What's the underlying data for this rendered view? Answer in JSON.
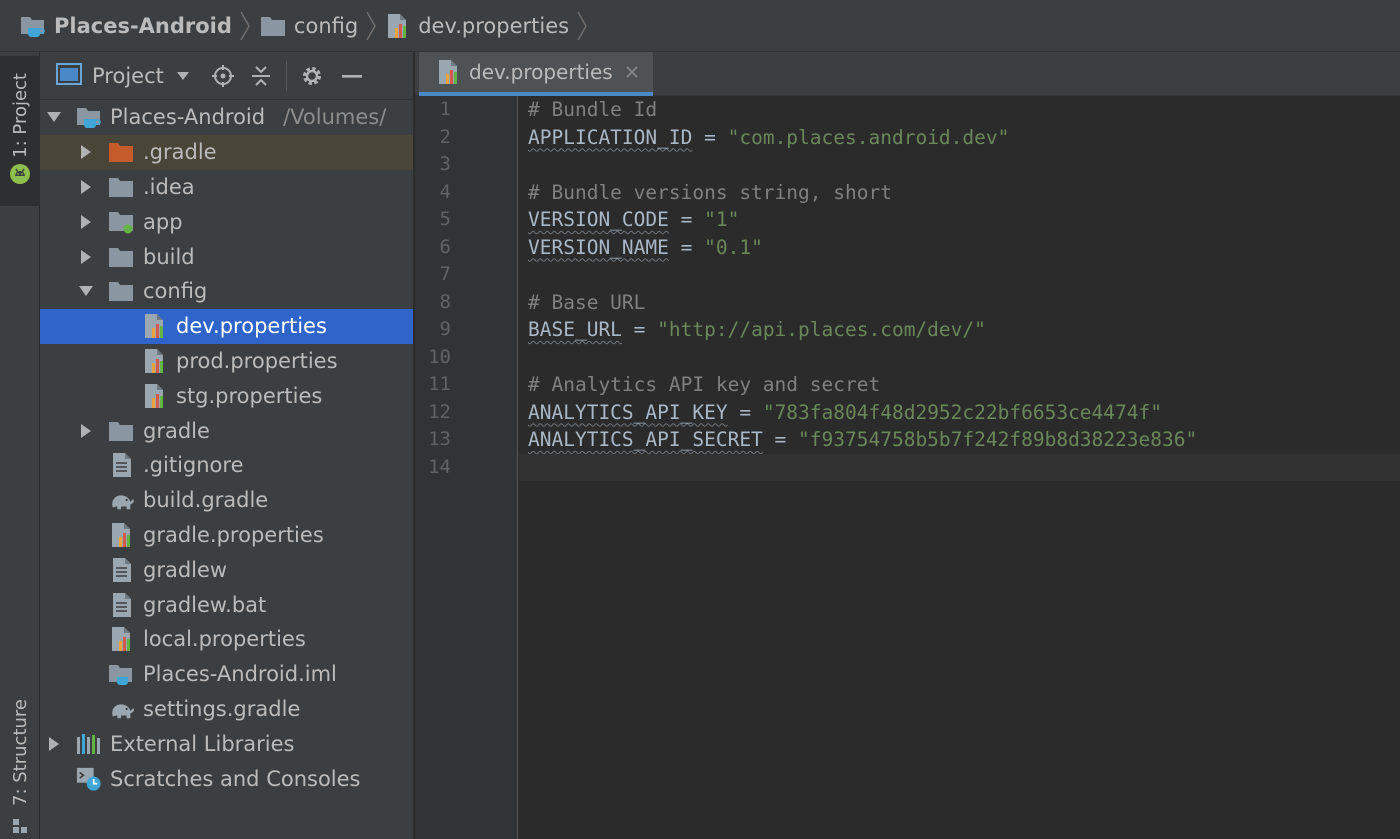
{
  "breadcrumb": [
    {
      "label": "Places-Android",
      "icon": "project-folder-icon"
    },
    {
      "label": "config",
      "icon": "folder-icon"
    },
    {
      "label": "dev.properties",
      "icon": "properties-file-icon"
    }
  ],
  "tool_stripe": {
    "project_tab": "1: Project",
    "structure_tab": "7: Structure"
  },
  "project_panel": {
    "title": "Project",
    "tree": [
      {
        "label": "Places-Android",
        "path": "/Volumes/",
        "icon": "project-folder-icon",
        "depth": 0,
        "expander": "expanded"
      },
      {
        "label": ".gradle",
        "icon": "folder-orange-icon",
        "depth": 1,
        "expander": "collapsed",
        "highlight": true
      },
      {
        "label": ".idea",
        "icon": "folder-icon",
        "depth": 1,
        "expander": "collapsed"
      },
      {
        "label": "app",
        "icon": "module-folder-icon",
        "depth": 1,
        "expander": "collapsed"
      },
      {
        "label": "build",
        "icon": "folder-icon",
        "depth": 1,
        "expander": "collapsed"
      },
      {
        "label": "config",
        "icon": "folder-icon",
        "depth": 1,
        "expander": "expanded"
      },
      {
        "label": "dev.properties",
        "icon": "properties-file-icon",
        "depth": 2,
        "selected": true
      },
      {
        "label": "prod.properties",
        "icon": "properties-file-icon",
        "depth": 2
      },
      {
        "label": "stg.properties",
        "icon": "properties-file-icon",
        "depth": 2
      },
      {
        "label": "gradle",
        "icon": "folder-icon",
        "depth": 1,
        "expander": "collapsed"
      },
      {
        "label": ".gitignore",
        "icon": "text-file-icon",
        "depth": 1
      },
      {
        "label": "build.gradle",
        "icon": "gradle-elephant-icon",
        "depth": 1
      },
      {
        "label": "gradle.properties",
        "icon": "properties-file-icon",
        "depth": 1
      },
      {
        "label": "gradlew",
        "icon": "text-file-icon",
        "depth": 1
      },
      {
        "label": "gradlew.bat",
        "icon": "text-file-icon",
        "depth": 1
      },
      {
        "label": "local.properties",
        "icon": "properties-file-icon",
        "depth": 1
      },
      {
        "label": "Places-Android.iml",
        "icon": "iml-file-icon",
        "depth": 1
      },
      {
        "label": "settings.gradle",
        "icon": "gradle-elephant-icon",
        "depth": 1
      },
      {
        "label": "External Libraries",
        "icon": "libraries-icon",
        "depth": 0,
        "expander": "collapsed"
      },
      {
        "label": "Scratches and Consoles",
        "icon": "scratches-icon",
        "depth": 0
      }
    ]
  },
  "editor": {
    "active_tab": "dev.properties",
    "current_line": 14,
    "lines": [
      {
        "n": "1",
        "type": "comment",
        "text": "# Bundle Id"
      },
      {
        "n": "2",
        "type": "pair",
        "key": "APPLICATION_ID",
        "eq": " = ",
        "value": "\"com.places.android.dev\""
      },
      {
        "n": "3",
        "type": "blank"
      },
      {
        "n": "4",
        "type": "comment",
        "text": "# Bundle versions string, short"
      },
      {
        "n": "5",
        "type": "pair",
        "key": "VERSION_CODE",
        "eq": " = ",
        "value": "\"1\""
      },
      {
        "n": "6",
        "type": "pair",
        "key": "VERSION_NAME",
        "eq": " = ",
        "value": "\"0.1\""
      },
      {
        "n": "7",
        "type": "blank"
      },
      {
        "n": "8",
        "type": "comment",
        "text": "# Base URL"
      },
      {
        "n": "9",
        "type": "pair",
        "key": "BASE_URL",
        "eq": " = ",
        "value": "\"http://api.places.com/dev/\""
      },
      {
        "n": "10",
        "type": "blank"
      },
      {
        "n": "11",
        "type": "comment",
        "text": "# Analytics API key and secret"
      },
      {
        "n": "12",
        "type": "pair",
        "key": "ANALYTICS_API_KEY",
        "eq": " = ",
        "value": "\"783fa804f48d2952c22bf6653ce4474f\""
      },
      {
        "n": "13",
        "type": "pair",
        "key": "ANALYTICS_API_SECRET",
        "eq": " = ",
        "value": "\"f93754758b5b7f242f89b8d38223e836\""
      },
      {
        "n": "14",
        "type": "blank"
      }
    ]
  },
  "colors": {
    "selection": "#2f65ca",
    "comment": "#808080",
    "key": "#a9b7c6",
    "string": "#6a8759",
    "tab_underline": "#4a88c7"
  }
}
